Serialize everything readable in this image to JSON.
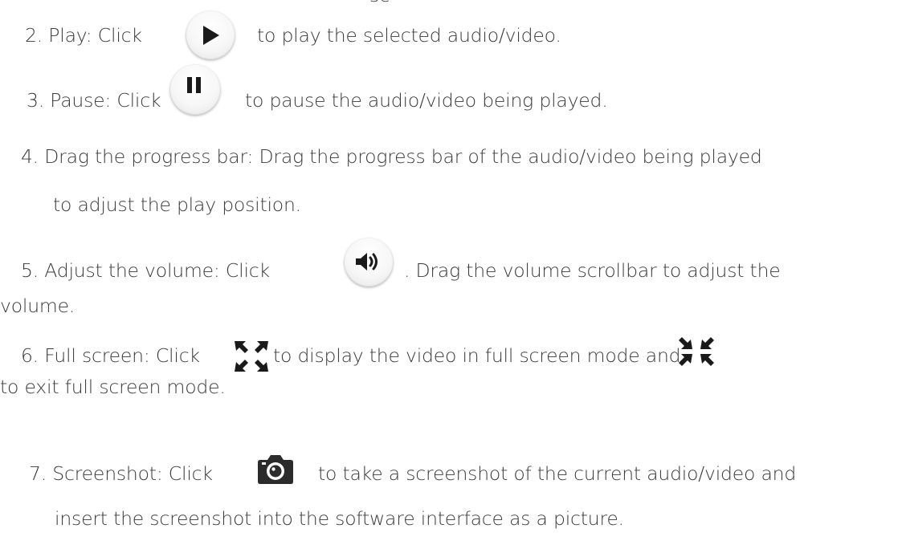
{
  "lines": {
    "top_fragment": "sc",
    "play": {
      "pre": "2.  Play: Click",
      "post": "to play the selected audio/video."
    },
    "pause": {
      "pre": "3.  Pause: Click",
      "post": "to pause the audio/video being played."
    },
    "drag_1": "4.  Drag the progress bar: Drag the progress bar of the audio/video being played",
    "drag_2": "to adjust the play position.",
    "volume_1": {
      "pre": "5.  Adjust  the  volume:  Click",
      "post": ". Drag the volume scrollbar to adjust the"
    },
    "volume_2": "volume.",
    "fullscreen_1": {
      "pre": "6.  Full screen: Click",
      "mid": "to display the video in full screen mode and"
    },
    "fullscreen_2": "to exit full screen mode.",
    "screenshot_1": {
      "pre": "7.  Screenshot: Click",
      "post": "to take a screenshot of the current audio/video and"
    },
    "screenshot_2": "insert the screenshot into the software interface as a picture."
  },
  "icons": {
    "play": "play-icon",
    "pause": "pause-icon",
    "volume": "volume-icon",
    "fullscreen_enter": "fullscreen-enter-icon",
    "fullscreen_exit": "fullscreen-exit-icon",
    "camera": "camera-icon"
  },
  "colors": {
    "text": "#3a3a3a",
    "icon": "#1a1a1a",
    "camera": "#2b2b2b"
  }
}
